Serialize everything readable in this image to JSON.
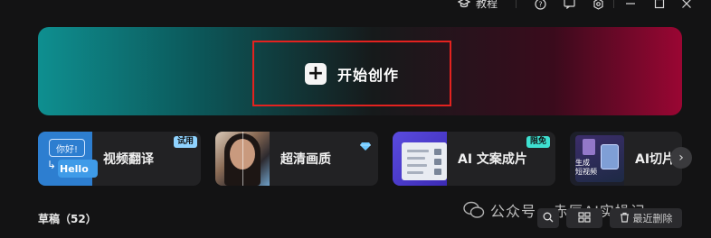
{
  "topbar": {
    "tutorial_label": "教程",
    "icons": [
      "tutorial-icon",
      "help-icon",
      "feedback-icon",
      "settings-icon",
      "minimize-icon",
      "maximize-icon",
      "close-icon"
    ]
  },
  "banner": {
    "create_label": "开始创作"
  },
  "tools": [
    {
      "label": "视频翻译",
      "badge": "试用",
      "thumb_text_1": "你好!",
      "thumb_text_2": "Hello"
    },
    {
      "label": "超清画质"
    },
    {
      "label": "AI 文案成片",
      "badge": "限免"
    },
    {
      "label": "AI切片",
      "thumb_text": "生成\n短视频"
    }
  ],
  "drafts": {
    "title": "草稿（52）",
    "recent_delete_label": "最近删除"
  },
  "watermark": {
    "text": "公众号 · 赤辰AI实操记"
  },
  "colors": {
    "accent_red": "#e3221f",
    "badge_blue": "#8fd3ff",
    "badge_teal": "#3ee0d0",
    "background": "#131314"
  }
}
